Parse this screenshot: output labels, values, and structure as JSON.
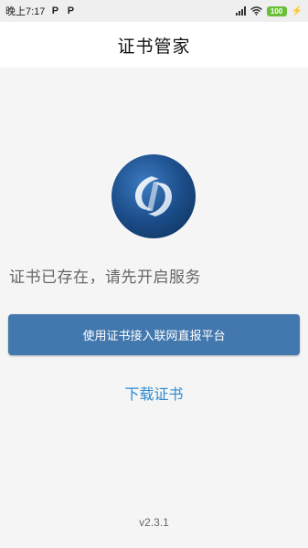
{
  "status_bar": {
    "time": "晚上7:17",
    "notification_icons": [
      "P",
      "P"
    ],
    "battery": "100"
  },
  "header": {
    "title": "证书管家"
  },
  "main": {
    "message": "证书已存在，请先开启服务",
    "primary_button_label": "使用证书接入联网直报平台",
    "download_link_label": "下载证书"
  },
  "footer": {
    "version": "v2.3.1"
  },
  "colors": {
    "primary_button": "#4378ae",
    "link": "#2f8ad0",
    "logo_blue": "#1d4f8c"
  }
}
